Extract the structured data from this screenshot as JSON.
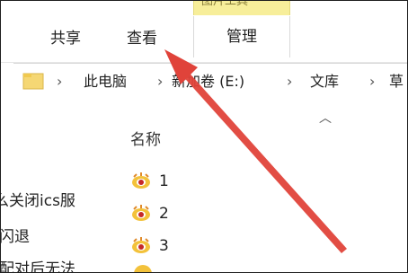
{
  "ribbon": {
    "tabs": [
      {
        "label": "共享"
      },
      {
        "label": "查看"
      },
      {
        "label": "管理"
      }
    ],
    "context_tab_label": "图片工具"
  },
  "address": {
    "segments": [
      "此电脑",
      "新加卷 (E:)",
      "文库",
      "草"
    ]
  },
  "nav": {
    "items": [
      "么关闭ics服",
      "闪退",
      "配对后无法"
    ]
  },
  "content": {
    "column_header": "名称",
    "files": [
      "1",
      "2",
      "3"
    ]
  },
  "colors": {
    "arrow": "#e0433a",
    "context_tab": "#f7ee9a"
  }
}
